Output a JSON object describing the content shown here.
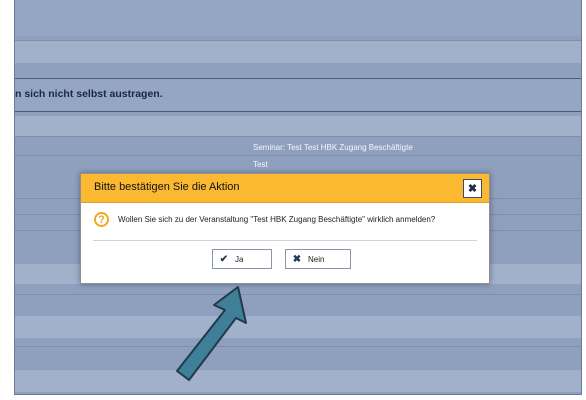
{
  "page": {
    "notice_text": "n sich nicht selbst austragen.",
    "rows": [
      "Seminar: Test Test HBK Zugang Beschäftigte",
      "Test"
    ]
  },
  "dialog": {
    "title": "Bitte bestätigen Sie die Aktion",
    "close_glyph": "✖",
    "question_icon": "?",
    "message": "Wollen Sie sich zu der Veranstaltung \"Test HBK Zugang Beschäftigte\" wirklich anmelden?",
    "yes_label": "Ja",
    "no_label": "Nein",
    "yes_icon": "✔",
    "no_icon": "✖"
  },
  "annotation": {
    "arrow_color": "#3f7f97"
  }
}
